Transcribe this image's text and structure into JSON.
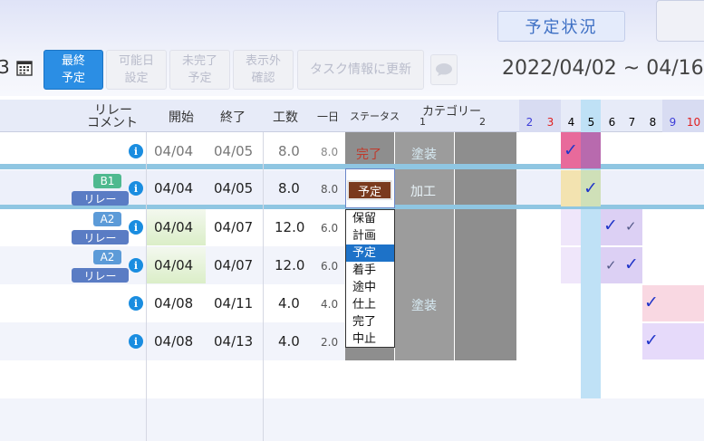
{
  "header": {
    "status_button": "予定状況",
    "left_fragment": "3",
    "date_range": "2022/04/02 ~ 04/16"
  },
  "toolbar": {
    "final_plan": [
      "最終",
      "予定"
    ],
    "possible_day": [
      "可能日",
      "設定"
    ],
    "incomplete": [
      "未完了",
      "予定"
    ],
    "hidden": [
      "表示外",
      "確認"
    ],
    "update_task": "タスク情報に更新"
  },
  "columns": {
    "relay_comment": [
      "リレー",
      "コメント"
    ],
    "start": "開始",
    "end": "終了",
    "hours": "工数",
    "per_day": "一日",
    "status": "ステータス",
    "category": "カテゴリー",
    "category_1": "1",
    "category_2": "2"
  },
  "days": [
    {
      "label": "2",
      "color": "#3d3dd8"
    },
    {
      "label": "3",
      "color": "#e02020"
    },
    {
      "label": "4",
      "color": "#111111"
    },
    {
      "label": "5",
      "color": "#111111"
    },
    {
      "label": "6",
      "color": "#111111"
    },
    {
      "label": "7",
      "color": "#111111"
    },
    {
      "label": "8",
      "color": "#111111"
    },
    {
      "label": "9",
      "color": "#3d3dd8"
    },
    {
      "label": "10",
      "color": "#e02020"
    }
  ],
  "rows": [
    {
      "start": "04/04",
      "end": "04/05",
      "hours": "8.0",
      "per_day": "8.0",
      "status": "完了",
      "category": "塗装",
      "badge": "",
      "relay": ""
    },
    {
      "start": "04/04",
      "end": "04/05",
      "hours": "8.0",
      "per_day": "8.0",
      "status": "予定",
      "category": "加工",
      "badge": "B1",
      "relay": "リレー"
    },
    {
      "start": "04/04",
      "end": "04/07",
      "hours": "12.0",
      "per_day": "6.0",
      "status": "",
      "category": "",
      "badge": "A2",
      "relay": "リレー"
    },
    {
      "start": "04/04",
      "end": "04/07",
      "hours": "12.0",
      "per_day": "6.0",
      "status": "",
      "category": "",
      "badge": "A2",
      "relay": "リレー"
    },
    {
      "start": "04/08",
      "end": "04/11",
      "hours": "4.0",
      "per_day": "4.0",
      "status": "",
      "category": "塗装",
      "badge": "",
      "relay": ""
    },
    {
      "start": "04/08",
      "end": "04/13",
      "hours": "4.0",
      "per_day": "2.0",
      "status": "",
      "category": "",
      "badge": "",
      "relay": ""
    }
  ],
  "info_glyph": "i",
  "status_options": [
    "保留",
    "計画",
    "予定",
    "着手",
    "途中",
    "仕上",
    "完了",
    "中止"
  ],
  "colors": {
    "accent": "#2b8ee4",
    "done_status": "#c0392b",
    "selected_status_bg": "#7a3a1e",
    "badge_b1": "#4fb98f",
    "badge_a2": "#5c9bd8",
    "relay_badge": "#5a7cc4"
  }
}
